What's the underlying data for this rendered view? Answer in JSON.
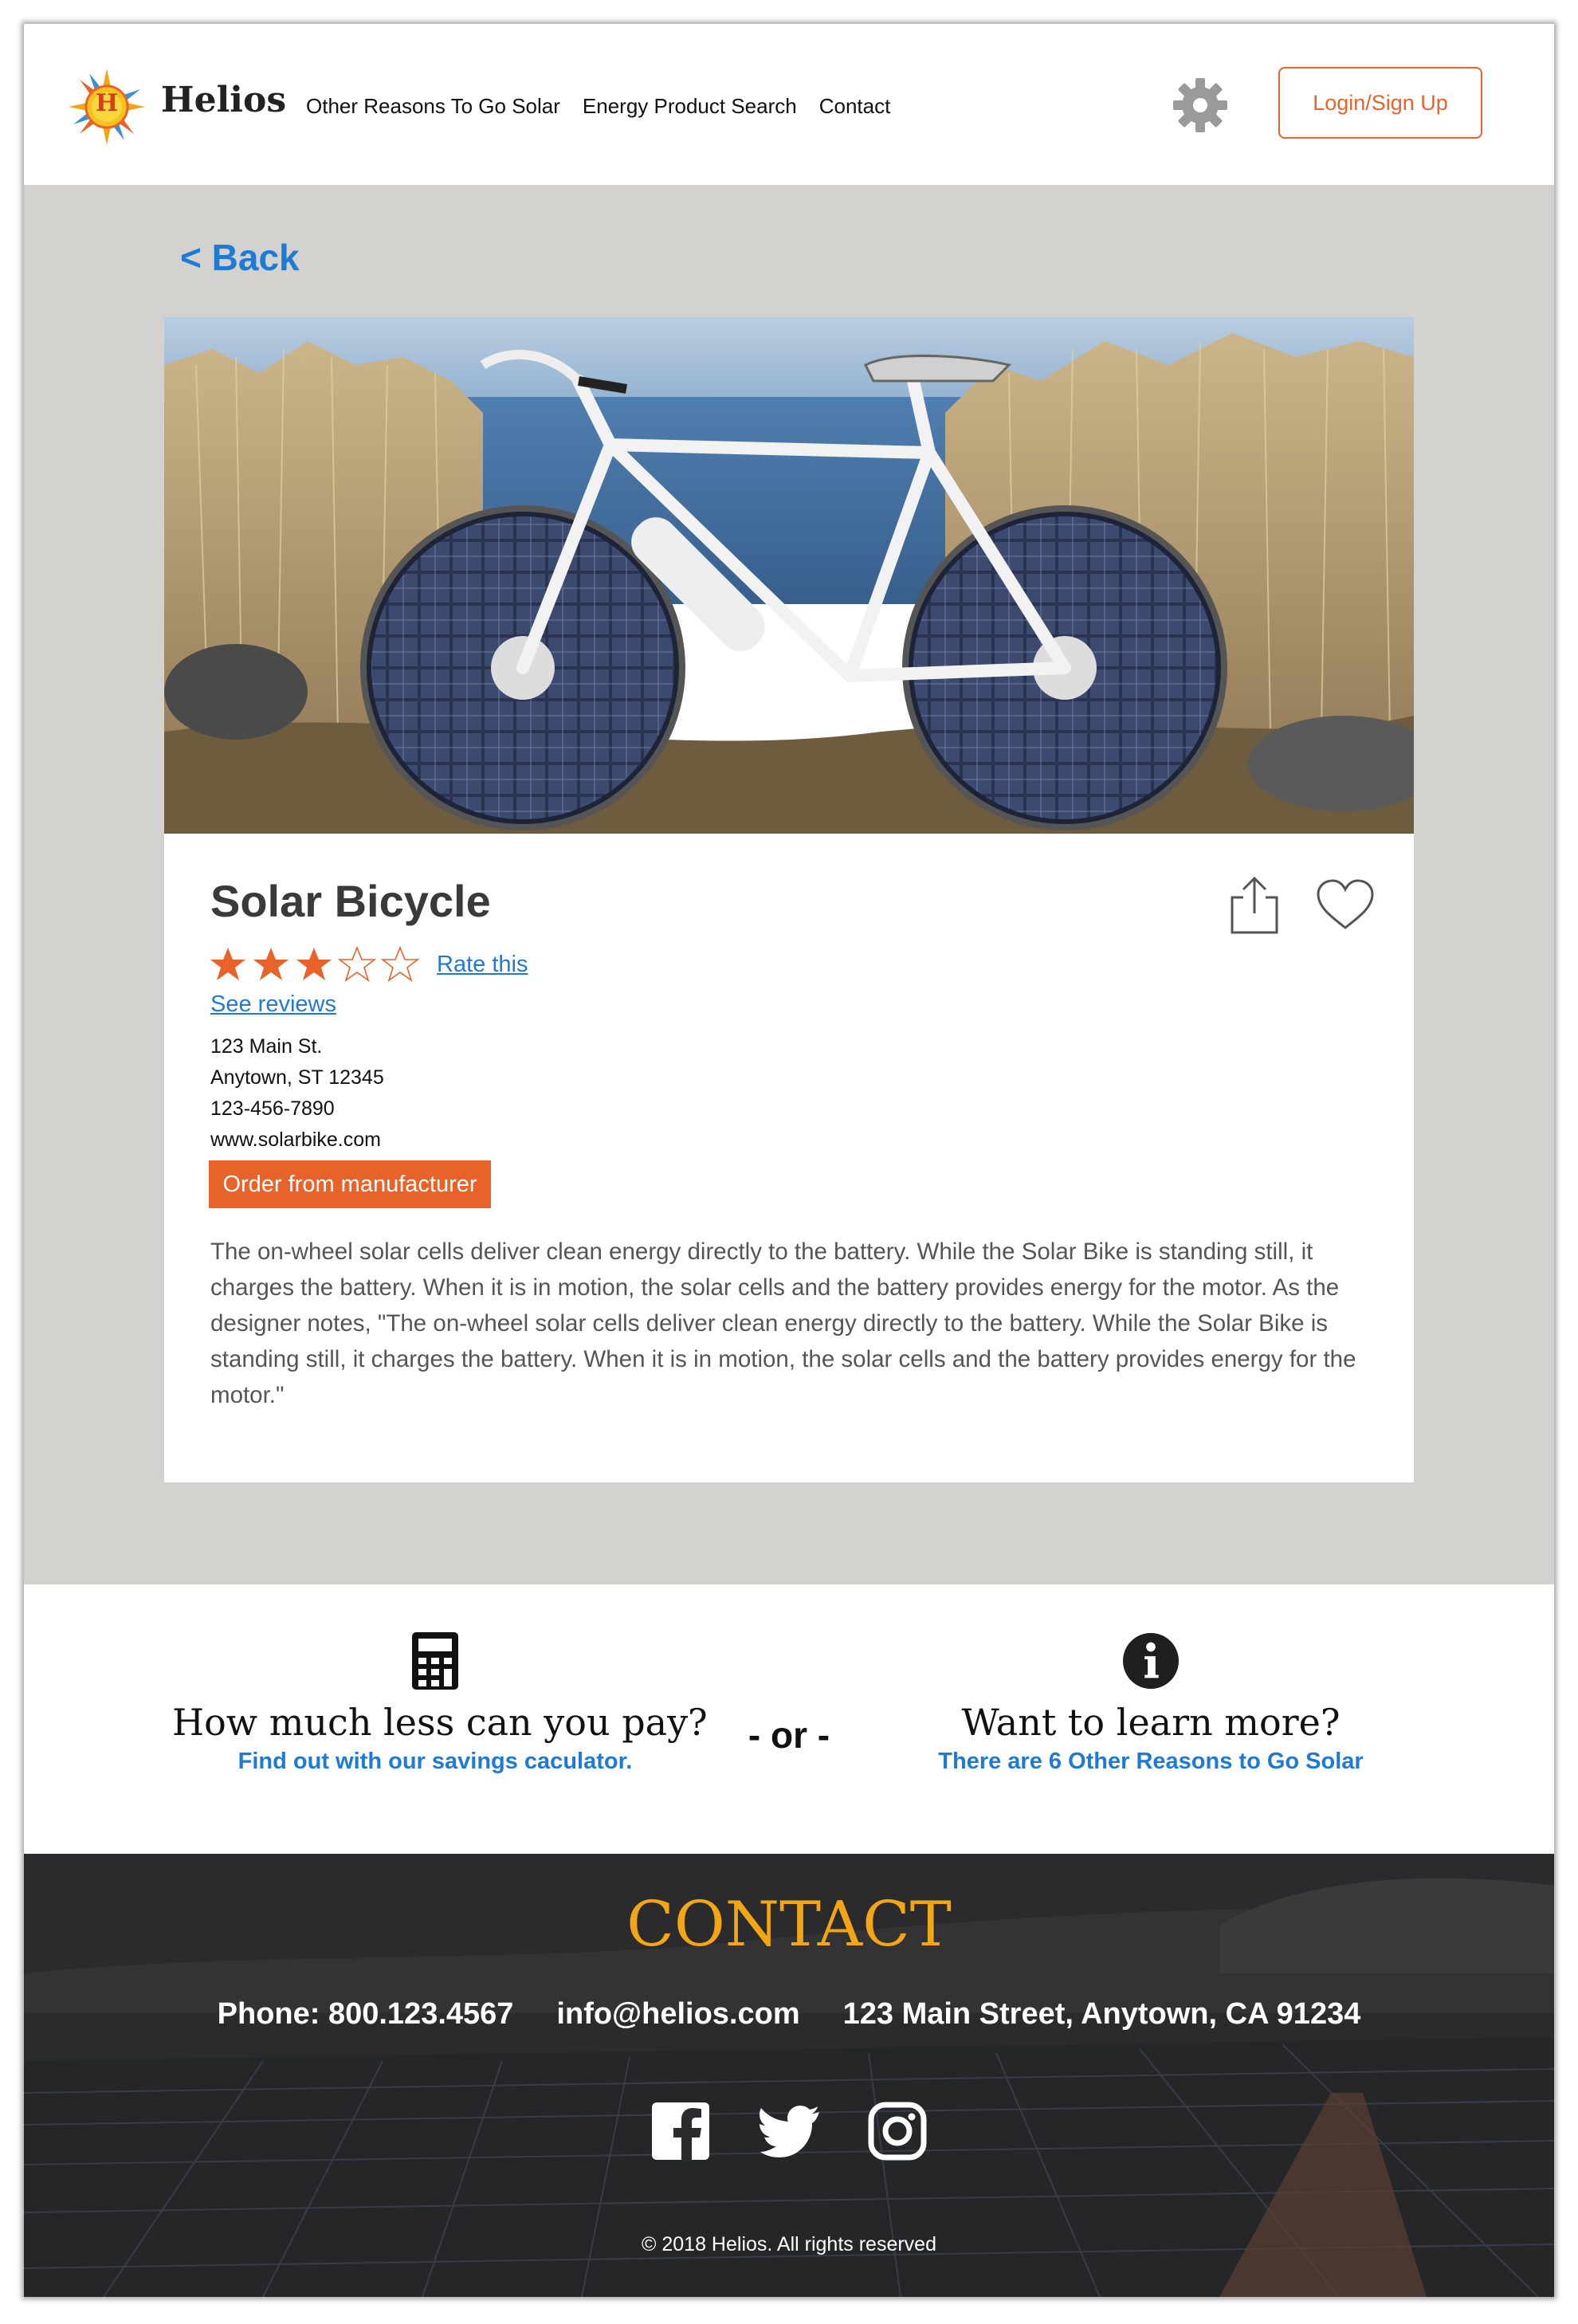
{
  "header": {
    "brand": "Helios",
    "logo_letter": "H",
    "nav": [
      "Other Reasons To Go Solar",
      "Energy Product Search",
      "Contact"
    ],
    "login_label": "Login/Sign Up",
    "icons": {
      "settings": "gear-icon"
    }
  },
  "main": {
    "back_label": "< Back",
    "product": {
      "title": "Solar Bicycle",
      "rating": 3,
      "rating_max": 5,
      "rate_label": "Rate this",
      "reviews_label": "See reviews",
      "address_line1": "123 Main St.",
      "address_line2": "Anytown, ST 12345",
      "phone": "123-456-7890",
      "website": "www.solarbike.com",
      "order_label": "Order from manufacturer",
      "description": "The on-wheel solar cells deliver clean energy directly to the battery. While the Solar Bike is standing still, it charges the battery. When it is in motion, the solar cells and the battery provides energy for the motor. As the designer notes, \"The on-wheel solar cells deliver clean energy directly to the battery. While the Solar Bike is standing still, it charges the battery. When it is in motion, the solar cells and the battery provides energy for the motor.\"",
      "icons": {
        "share": "share-icon",
        "favorite": "heart-icon"
      }
    }
  },
  "cta": {
    "left_title": "How much less can you pay?",
    "left_link": "Find out with our savings caculator.",
    "or_label": "- or -",
    "right_title": "Want to learn more?",
    "right_link": "There are 6 Other Reasons to Go Solar",
    "icons": {
      "left": "calculator-icon",
      "right": "info-icon"
    }
  },
  "footer": {
    "title": "CONTACT",
    "phone": "Phone: 800.123.4567",
    "email": "info@helios.com",
    "address": "123 Main Street, Anytown, CA 91234",
    "social": [
      "facebook-icon",
      "twitter-icon",
      "instagram-icon"
    ],
    "copyright": "© 2018 Helios. All rights reserved"
  },
  "colors": {
    "accent_orange": "#e8632a",
    "link_blue": "#1f7ad6",
    "contact_gold": "#f2a515",
    "page_gray": "#d3d2cf",
    "footer_dark": "#2e2e30"
  }
}
